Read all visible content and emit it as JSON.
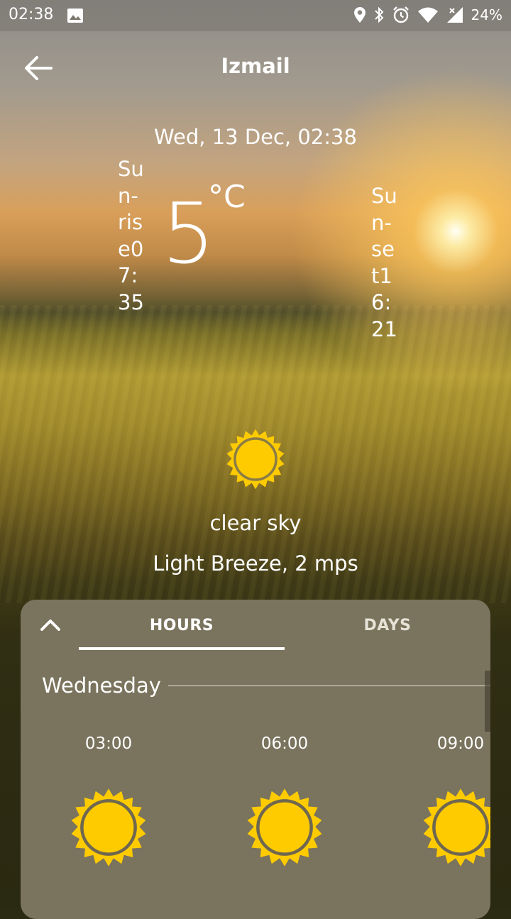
{
  "status": {
    "time": "02:38",
    "battery": "24%",
    "icons": [
      "image-icon",
      "location-icon",
      "bluetooth-icon",
      "alarm-icon",
      "wifi-icon",
      "signal-icon",
      "battery-icon"
    ]
  },
  "header": {
    "city": "Izmail"
  },
  "current": {
    "datetime": "Wed, 13 Dec, 02:38",
    "temperature": "5",
    "unit": "°C",
    "sunrise": "Sun-rise07:35",
    "sunset": "Sun-set16:21",
    "condition": "clear sky",
    "wind": "Light Breeze, 2 mps",
    "icon": "sun-icon"
  },
  "forecast": {
    "tabs": [
      "HOURS",
      "DAYS"
    ],
    "selected_tab": "HOURS",
    "day": "Wednesday",
    "hours": [
      {
        "time": "03:00",
        "icon": "sun-icon"
      },
      {
        "time": "06:00",
        "icon": "sun-icon"
      },
      {
        "time": "09:00",
        "icon": "sun-icon"
      }
    ]
  },
  "colors": {
    "panel": "#7a735d",
    "sun_fill": "#fecb00",
    "sun_ring": "#7a735d"
  }
}
